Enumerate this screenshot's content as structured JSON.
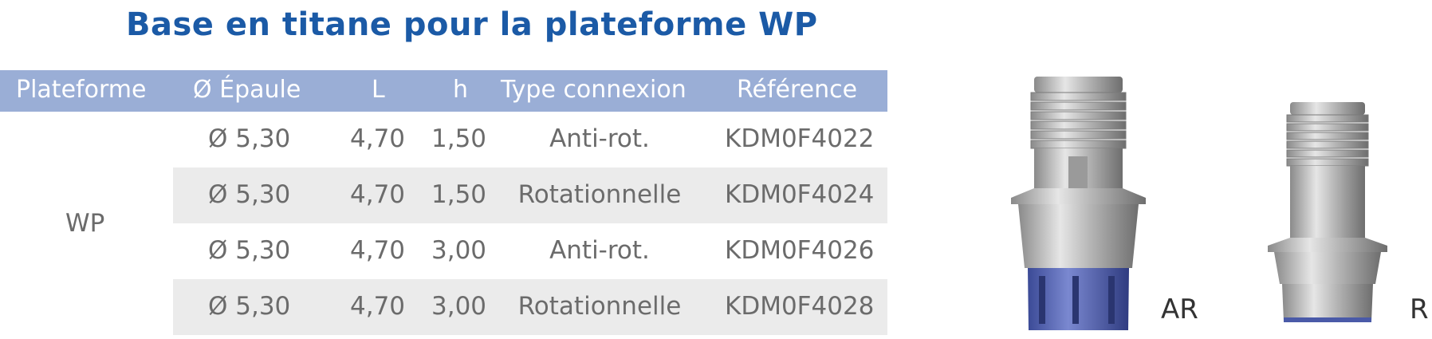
{
  "title": "Base en titane pour la plateforme WP",
  "table": {
    "headers": [
      "Plateforme",
      "Ø Épaule",
      "L",
      "h",
      "Type connexion",
      "Référence"
    ],
    "platform": "WP",
    "rows": [
      {
        "epaule": "Ø 5,30",
        "L": "4,70",
        "h": "1,50",
        "type": "Anti-rot.",
        "ref": "KDM0F4022"
      },
      {
        "epaule": "Ø 5,30",
        "L": "4,70",
        "h": "1,50",
        "type": "Rotationnelle",
        "ref": "KDM0F4024"
      },
      {
        "epaule": "Ø 5,30",
        "L": "4,70",
        "h": "3,00",
        "type": "Anti-rot.",
        "ref": "KDM0F4026"
      },
      {
        "epaule": "Ø 5,30",
        "L": "4,70",
        "h": "3,00",
        "type": "Rotationnelle",
        "ref": "KDM0F4028"
      }
    ]
  },
  "images": [
    {
      "label": "AR",
      "icon": "abutment-anti-rotational-icon"
    },
    {
      "label": "R",
      "icon": "abutment-rotational-icon"
    }
  ],
  "colors": {
    "title": "#1b5aa6",
    "header_bg": "#9aaed6",
    "row_shade": "#ebebeb",
    "text": "#6b6b6b",
    "connector_blue": "#4a5aa8"
  }
}
